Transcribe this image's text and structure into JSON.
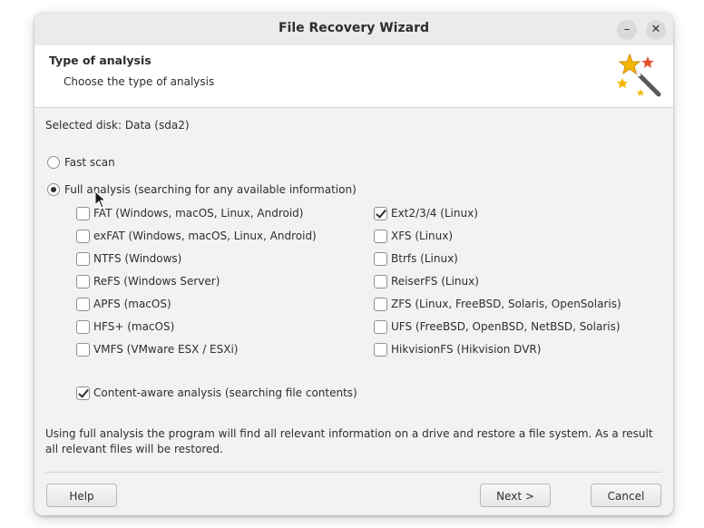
{
  "window": {
    "title": "File Recovery Wizard",
    "minimize_label": "–",
    "close_label": "✕"
  },
  "header": {
    "title": "Type of analysis",
    "subtitle": "Choose the type of analysis",
    "icon": "magic-wand-icon"
  },
  "selected_disk": "Selected disk: Data (sda2)",
  "scan_options": {
    "fast_scan": {
      "label": "Fast scan",
      "selected": false
    },
    "full_analysis": {
      "label": "Full analysis (searching for any available information)",
      "selected": true
    }
  },
  "filesystems_left": [
    {
      "label": "FAT (Windows, macOS, Linux, Android)",
      "checked": false
    },
    {
      "label": "exFAT (Windows, macOS, Linux, Android)",
      "checked": false
    },
    {
      "label": "NTFS (Windows)",
      "checked": false
    },
    {
      "label": "ReFS (Windows Server)",
      "checked": false
    },
    {
      "label": "APFS (macOS)",
      "checked": false
    },
    {
      "label": "HFS+ (macOS)",
      "checked": false
    },
    {
      "label": "VMFS (VMware ESX / ESXi)",
      "checked": false
    }
  ],
  "filesystems_right": [
    {
      "label": "Ext2/3/4 (Linux)",
      "checked": true
    },
    {
      "label": "XFS (Linux)",
      "checked": false
    },
    {
      "label": "Btrfs (Linux)",
      "checked": false
    },
    {
      "label": "ReiserFS (Linux)",
      "checked": false
    },
    {
      "label": "ZFS (Linux, FreeBSD, Solaris, OpenSolaris)",
      "checked": false
    },
    {
      "label": "UFS (FreeBSD, OpenBSD, NetBSD, Solaris)",
      "checked": false
    },
    {
      "label": "HikvisionFS (Hikvision DVR)",
      "checked": false
    }
  ],
  "content_aware": {
    "label": "Content-aware analysis (searching file contents)",
    "checked": true
  },
  "info_text": "Using full analysis the program will find all relevant information on a drive and restore a file system. As a result all relevant files will be restored.",
  "buttons": {
    "help": "Help",
    "next": "Next >",
    "cancel": "Cancel"
  }
}
